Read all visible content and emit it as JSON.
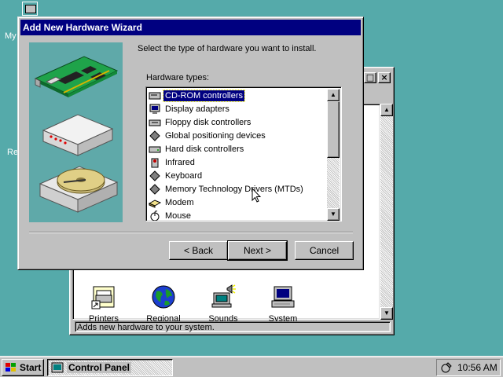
{
  "desktop": {
    "icons": [
      {
        "label": "My"
      },
      {
        "label": "Re"
      }
    ]
  },
  "control_panel": {
    "title": "Control Panel",
    "icons": [
      {
        "label": "Printers",
        "icon": "printer-icon"
      },
      {
        "label": "Regional",
        "icon": "globe-icon"
      },
      {
        "label": "Sounds",
        "icon": "sounds-icon"
      },
      {
        "label": "System",
        "icon": "system-icon"
      }
    ],
    "status": "Adds new hardware to your system.",
    "buttons": {
      "maximize": "□",
      "close": "×"
    }
  },
  "wizard": {
    "title": "Add New Hardware Wizard",
    "instruction": "Select the type of hardware you want to install.",
    "list_label": "Hardware types:",
    "items": [
      {
        "label": "CD-ROM controllers",
        "icon": "cdrom-icon",
        "selected": true
      },
      {
        "label": "Display adapters",
        "icon": "display-icon",
        "selected": false
      },
      {
        "label": "Floppy disk controllers",
        "icon": "floppy-icon",
        "selected": false
      },
      {
        "label": "Global positioning devices",
        "icon": "gps-icon",
        "selected": false
      },
      {
        "label": "Hard disk controllers",
        "icon": "harddisk-icon",
        "selected": false
      },
      {
        "label": "Infrared",
        "icon": "infrared-icon",
        "selected": false
      },
      {
        "label": "Keyboard",
        "icon": "keyboard-icon",
        "selected": false
      },
      {
        "label": "Memory Technology Drivers (MTDs)",
        "icon": "mtd-icon",
        "selected": false
      },
      {
        "label": "Modem",
        "icon": "modem-icon",
        "selected": false
      },
      {
        "label": "Mouse",
        "icon": "mouse-icon",
        "selected": false
      }
    ],
    "buttons": {
      "back": "< Back",
      "next": "Next >",
      "cancel": "Cancel"
    }
  },
  "taskbar": {
    "start_label": "Start",
    "task_label": "Control Panel",
    "clock": "10:56 AM"
  },
  "colors": {
    "desktop": "#55aaaa",
    "title_active": "#000080",
    "face": "#c0c0c0",
    "selection": "#000080"
  }
}
